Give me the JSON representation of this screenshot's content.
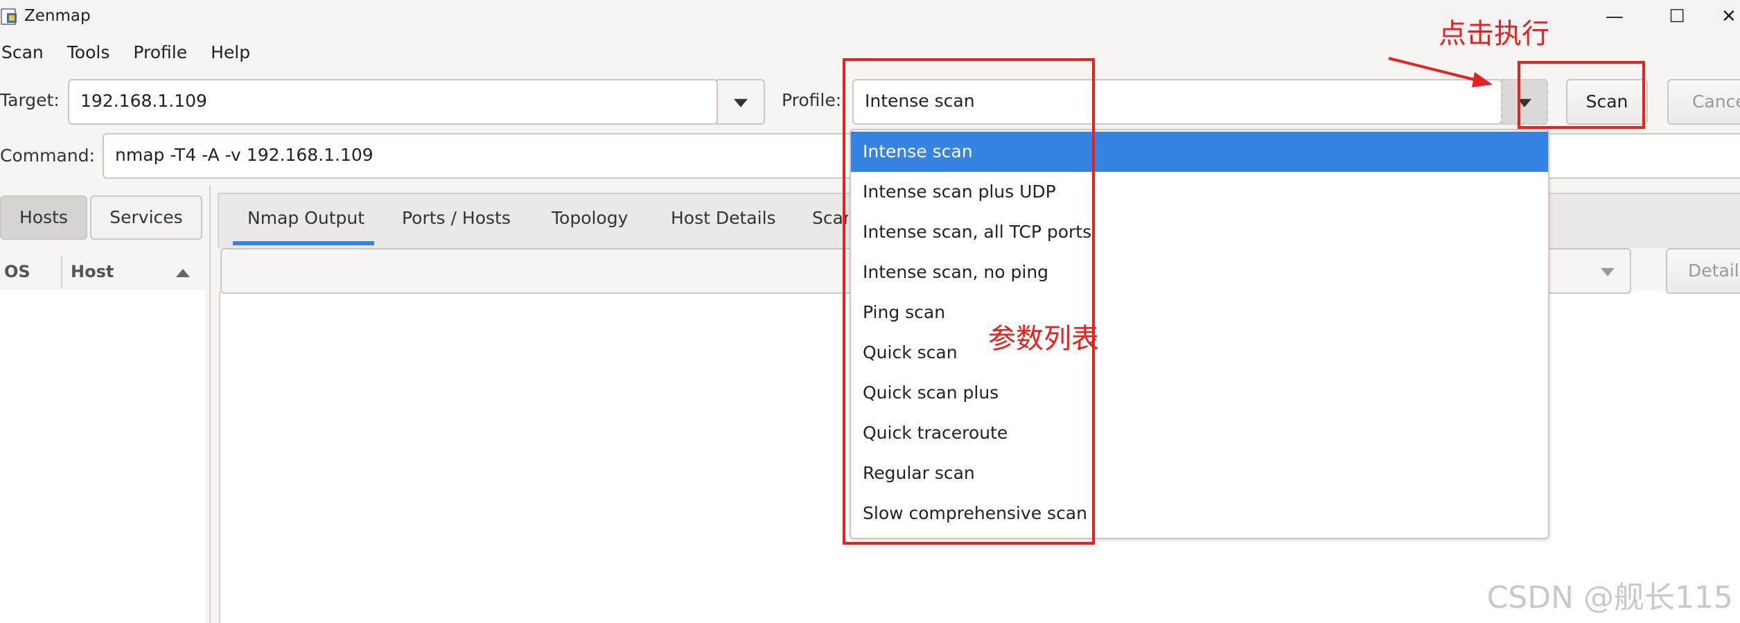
{
  "window": {
    "title": "Zenmap",
    "minimize_glyph": "—",
    "maximize_glyph": "☐",
    "close_glyph": "✕"
  },
  "menu": [
    "Scan",
    "Tools",
    "Profile",
    "Help"
  ],
  "target": {
    "label": "Target:",
    "value": "192.168.1.109"
  },
  "profile": {
    "label": "Profile:",
    "value": "Intense scan"
  },
  "buttons": {
    "scan": "Scan",
    "cancel": "Cance"
  },
  "command": {
    "label": "Command:",
    "value": "nmap -T4 -A -v 192.168.1.109"
  },
  "left_tabs": {
    "hosts": "Hosts",
    "services": "Services"
  },
  "host_columns": {
    "os": "OS",
    "host": "Host"
  },
  "result_tabs": [
    "Nmap Output",
    "Ports / Hosts",
    "Topology",
    "Host Details",
    "Scan"
  ],
  "details_button": "Details",
  "profile_options": [
    "Intense scan",
    "Intense scan plus UDP",
    "Intense scan, all TCP ports",
    "Intense scan, no ping",
    "Ping scan",
    "Quick scan",
    "Quick scan plus",
    "Quick traceroute",
    "Regular scan",
    "Slow comprehensive scan"
  ],
  "annotations": {
    "click_execute": "点击执行",
    "param_list": "参数列表"
  },
  "watermark": "CSDN @舰长115",
  "colors": {
    "accent": "#3584e4",
    "annotation_red": "#e8211f"
  }
}
